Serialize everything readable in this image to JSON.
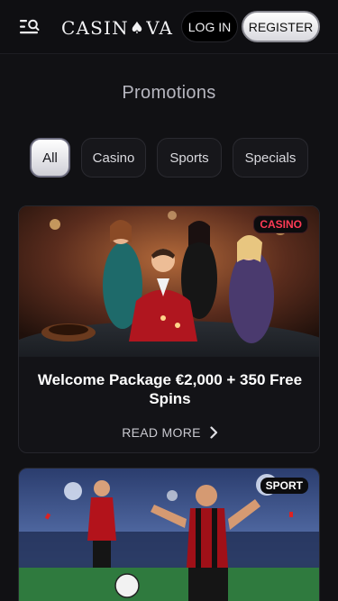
{
  "header": {
    "logo_text_left": "CASIN",
    "logo_spade": "♠",
    "logo_text_right": "VA",
    "login_label": "LOG IN",
    "register_label": "REGISTER"
  },
  "page": {
    "title": "Promotions"
  },
  "tabs": [
    {
      "label": "All",
      "active": true
    },
    {
      "label": "Casino",
      "active": false
    },
    {
      "label": "Sports",
      "active": false
    },
    {
      "label": "Specials",
      "active": false
    }
  ],
  "promotions": [
    {
      "badge": "CASINO",
      "title": "Welcome Package €2,000 + 350 Free Spins",
      "read_more": "READ MORE"
    },
    {
      "badge": "SPORT"
    }
  ],
  "colors": {
    "background": "#111114",
    "casino_badge": "#ff3b55",
    "active_tab": "#ffffff"
  },
  "icons": {
    "menu": "menu-search-icon",
    "read_more": "chevron-right-icon"
  }
}
